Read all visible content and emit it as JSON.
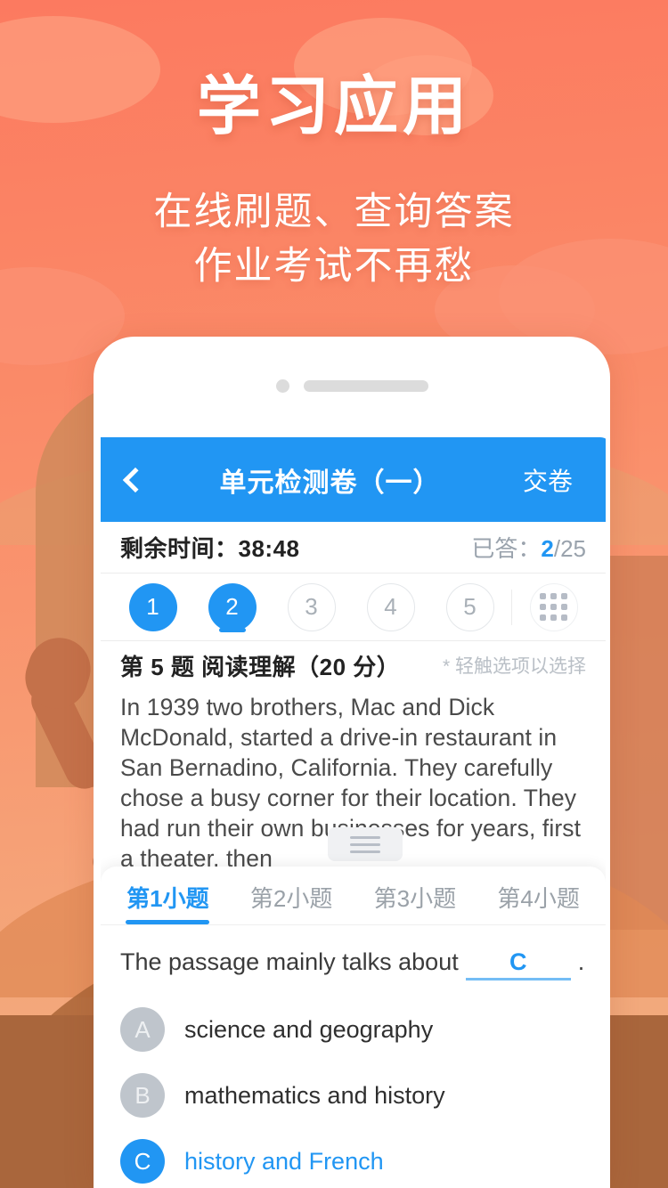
{
  "promo": {
    "headline": "学习应用",
    "subline_1": "在线刷题、查询答案",
    "subline_2": "作业考试不再愁",
    "brand_color": "#fc7a60"
  },
  "app": {
    "accent_color": "#2196f3",
    "navbar": {
      "back_icon": "chevron-left-icon",
      "title": "单元检测卷（一）",
      "action_label": "交卷"
    },
    "status_bar": {
      "time_label": "剩余时间：38:48",
      "answered_prefix": "已答：",
      "answered_count": "2",
      "answered_total": "/25"
    },
    "question_pills": [
      {
        "label": "1",
        "state": "answered"
      },
      {
        "label": "2",
        "state": "current"
      },
      {
        "label": "3",
        "state": "unanswered"
      },
      {
        "label": "4",
        "state": "unanswered"
      },
      {
        "label": "5",
        "state": "unanswered"
      }
    ],
    "grid_button_icon": "grid-icon",
    "question_meta": {
      "title": "第 5 题  阅读理解（20 分）",
      "hint": "* 轻触选项以选择"
    },
    "passage": "In 1939 two brothers, Mac and Dick McDonald, started a drive-in restaurant in San Bernadino, California. They carefully chose a busy corner for their location. They had run their own businesses for years, first a theater, then",
    "drag_handle_icon": "drag-handle-icon",
    "sub_tabs": [
      {
        "label": "第1小题",
        "active": true
      },
      {
        "label": "第2小题",
        "active": false
      },
      {
        "label": "第3小题",
        "active": false
      },
      {
        "label": "第4小题",
        "active": false
      }
    ],
    "question": {
      "stem_prefix": "The passage mainly talks about",
      "filled_answer": "C",
      "stem_suffix": ".",
      "options": [
        {
          "letter": "A",
          "text": "science and geography",
          "selected": false
        },
        {
          "letter": "B",
          "text": "mathematics and history",
          "selected": false
        },
        {
          "letter": "C",
          "text": "history and French",
          "selected": true
        }
      ]
    }
  }
}
